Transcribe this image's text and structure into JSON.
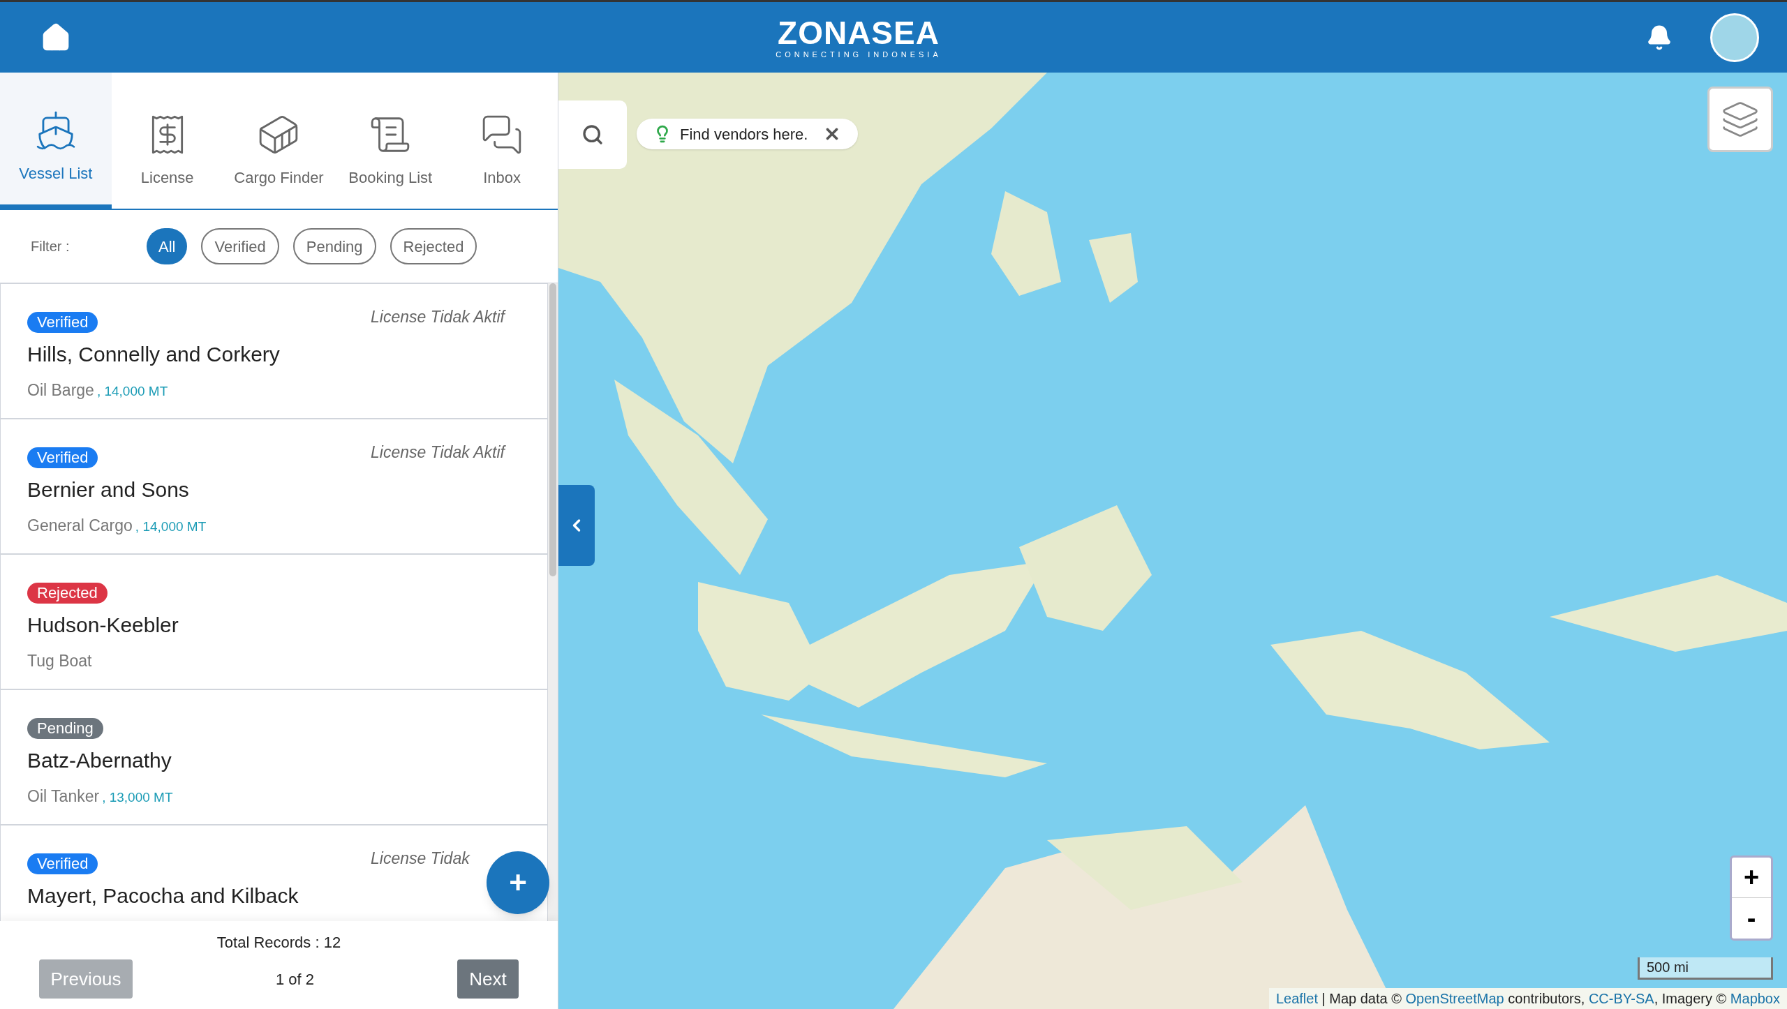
{
  "header": {
    "logo": "ZONASEA",
    "tagline": "CONNECTING INDONESIA"
  },
  "tabs": [
    {
      "label": "Vessel List",
      "selected": true,
      "kind": "ship"
    },
    {
      "label": "License",
      "selected": false,
      "kind": "license"
    },
    {
      "label": "Cargo Finder",
      "selected": false,
      "kind": "cargo"
    },
    {
      "label": "Booking List",
      "selected": false,
      "kind": "booking"
    },
    {
      "label": "Inbox",
      "selected": false,
      "kind": "inbox"
    }
  ],
  "filter": {
    "label": "Filter :",
    "options": [
      {
        "label": "All",
        "selected": true
      },
      {
        "label": "Verified",
        "selected": false
      },
      {
        "label": "Pending",
        "selected": false
      },
      {
        "label": "Rejected",
        "selected": false
      }
    ]
  },
  "vessels": [
    {
      "status": "Verified",
      "kind": "verified",
      "name": "Hills, Connelly and Corkery",
      "type": "Oil Barge",
      "capacity": ", 14,000 MT",
      "license": "License Tidak Aktif"
    },
    {
      "status": "Verified",
      "kind": "verified",
      "name": "Bernier and Sons",
      "type": "General Cargo",
      "capacity": ", 14,000 MT",
      "license": "License Tidak Aktif"
    },
    {
      "status": "Rejected",
      "kind": "rejected",
      "name": "Hudson-Keebler",
      "type": "Tug Boat"
    },
    {
      "status": "Pending",
      "kind": "pending",
      "name": "Batz-Abernathy",
      "type": "Oil Tanker",
      "capacity": ", 13,000 MT"
    },
    {
      "status": "Verified",
      "kind": "verified",
      "name": "Mayert, Pacocha and Kilback",
      "license": "License Tidak"
    }
  ],
  "pagination": {
    "total": "Total Records : 12",
    "page": "1 of 2",
    "previous": {
      "label": "Previous",
      "disabled": true
    },
    "next": {
      "label": "Next",
      "disabled": false
    }
  },
  "add_button": "+",
  "map": {
    "tooltip": "Find vendors here.",
    "zoom_in": "+",
    "zoom_out": "-",
    "scale": "500 mi",
    "attribution": [
      {
        "kind": "link",
        "text": "Leaflet"
      },
      {
        "kind": "text",
        "text": " | Map data © "
      },
      {
        "kind": "link",
        "text": "OpenStreetMap"
      },
      {
        "kind": "text",
        "text": " contributors, "
      },
      {
        "kind": "link",
        "text": "CC-BY-SA"
      },
      {
        "kind": "text",
        "text": ", Imagery © "
      },
      {
        "kind": "link",
        "text": "Mapbox"
      }
    ]
  }
}
